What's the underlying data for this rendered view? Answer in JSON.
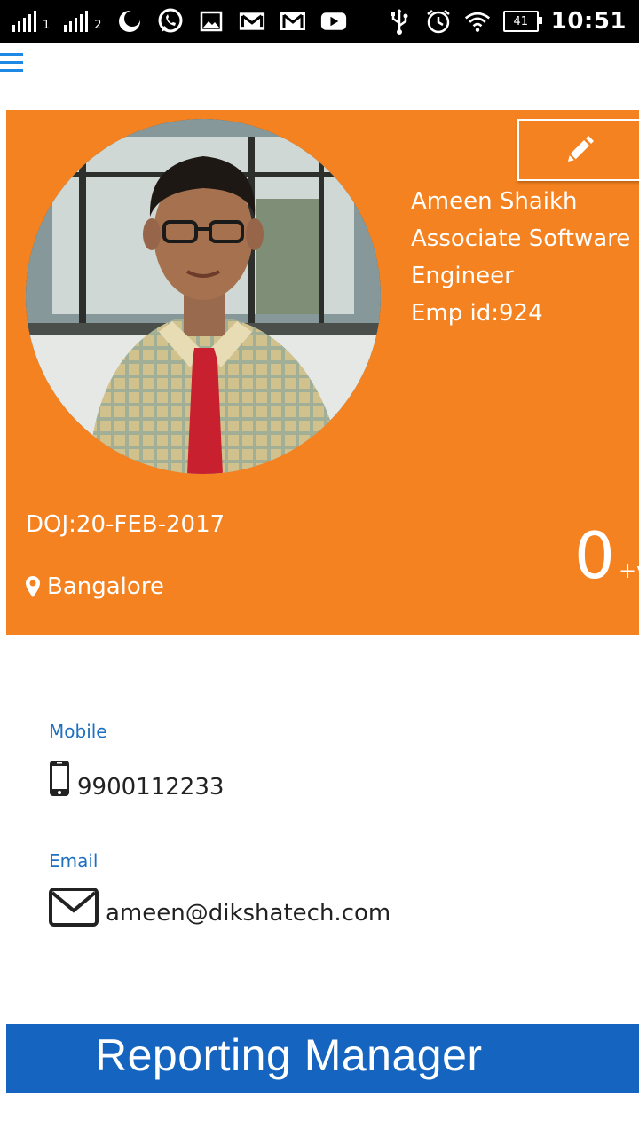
{
  "status_bar": {
    "sim1_label": "1",
    "sim2_label": "2",
    "battery_level": "41",
    "time": "10:51",
    "icons": [
      "signal-icon",
      "signal-icon",
      "moon-icon",
      "whatsapp-icon",
      "gallery-icon",
      "gmail-icon",
      "gmail-icon",
      "youtube-icon",
      "usb-icon",
      "alarm-icon",
      "wifi-icon",
      "battery-icon"
    ]
  },
  "app_bar": {
    "menu_icon": "hamburger-menu-icon"
  },
  "profile": {
    "name": "Ameen Shaikh",
    "designation_line1": "Associate Software",
    "designation_line2": "Engineer",
    "emp_id": "Emp id:924",
    "doj": "DOJ:20-FEB-2017",
    "location": "Bangalore",
    "counter_value": "0",
    "counter_suffix": "+v",
    "edit_icon": "pencil-icon",
    "card_color": "#f58220"
  },
  "contact": {
    "mobile_label": "Mobile",
    "mobile_value": "9900112233",
    "email_label": "Email",
    "email_value": "ameen@dikshatech.com",
    "label_color": "#1e6fc0"
  },
  "reporting_manager": {
    "title": "Reporting Manager",
    "bar_color": "#1565c0"
  }
}
